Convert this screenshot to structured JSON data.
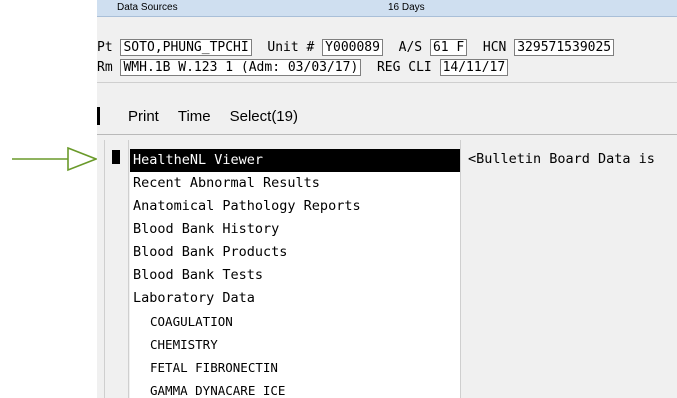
{
  "window": {
    "title_left": "Data Sources",
    "title_center": "16 Days"
  },
  "patient": {
    "pt_label": "Pt",
    "pt_value": "SOTO,PHUNG_TPCHI",
    "unit_label": "Unit #",
    "unit_value": "Y000089",
    "as_label": "A/S",
    "as_value": "61 F",
    "hcn_label": "HCN",
    "hcn_value": "329571539025",
    "rm_label": "Rm",
    "rm_value": "WMH.1B W.123 1 (Adm: 03/03/17)",
    "reg_label": "REG CLI",
    "reg_value": "14/11/17"
  },
  "toolbar": {
    "print": "Print",
    "time": "Time",
    "select": "Select(19)"
  },
  "list": {
    "items": [
      {
        "label": "HealtheNL Viewer",
        "selected": true
      },
      {
        "label": "Recent Abnormal Results"
      },
      {
        "label": "Anatomical Pathology Reports"
      },
      {
        "label": "Blood Bank History"
      },
      {
        "label": "Blood Bank Products"
      },
      {
        "label": "Blood Bank Tests"
      },
      {
        "label": "Laboratory Data"
      },
      {
        "label": "COAGULATION",
        "sub": true
      },
      {
        "label": "CHEMISTRY",
        "sub": true
      },
      {
        "label": "FETAL FIBRONECTIN",
        "sub": true
      },
      {
        "label": "GAMMA DYNACARE ICE",
        "sub": true
      }
    ]
  },
  "bulletin": {
    "text": "<Bulletin Board Data is"
  },
  "colors": {
    "arrow": "#6a9a2a",
    "titlebar": "#cfdff0",
    "selection": "#000000"
  }
}
